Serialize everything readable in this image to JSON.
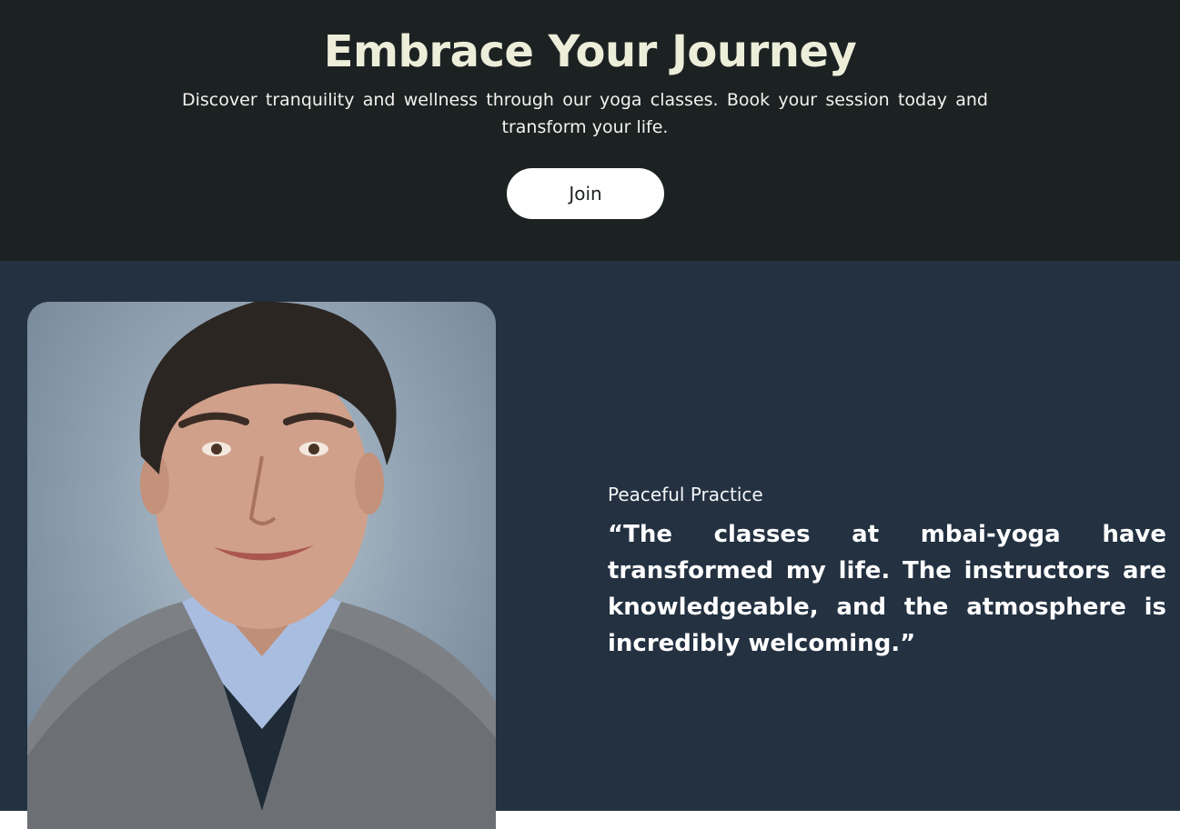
{
  "hero": {
    "title": "Embrace Your Journey",
    "subtitle": "Discover tranquility and wellness through our yoga classes. Book your session today and transform your life.",
    "join_label": "Join"
  },
  "testimonial": {
    "photo_icon": "person-portrait",
    "label": "Peaceful Practice",
    "quote": "“The classes at mbai-yoga have transformed my life. The instructors are knowledgeable, and the atmosphere is incredibly welcoming.”"
  },
  "colors": {
    "hero_bg": "#1c2122",
    "hero_title": "#eceed9",
    "testimonial_bg": "#233141",
    "button_bg": "#ffffff"
  }
}
